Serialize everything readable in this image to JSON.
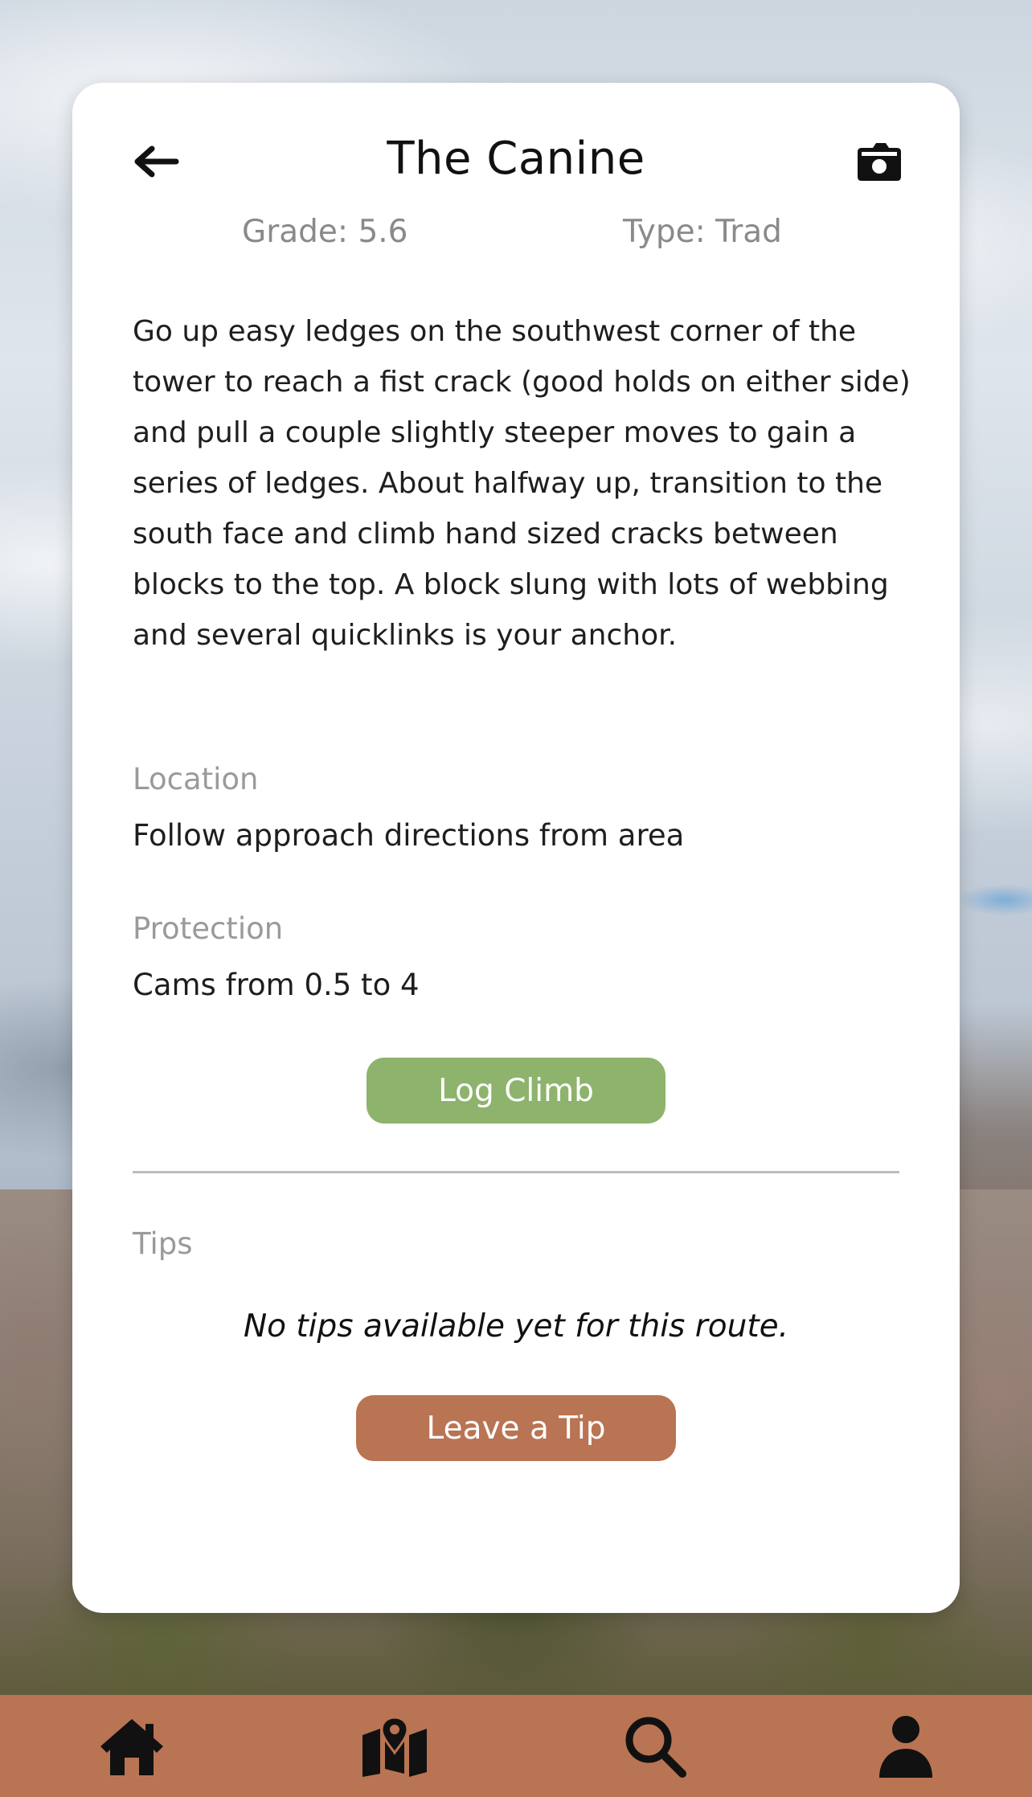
{
  "route": {
    "title": "The Canine",
    "grade": "Grade: 5.6",
    "type": "Type: Trad",
    "description": "Go up easy ledges on the southwest corner of the tower to reach a fist crack (good holds on either side) and pull a couple slightly steeper moves to gain a series of ledges. About halfway up, transition to the south face and climb hand sized cracks between blocks to the top. A block slung with lots of webbing and several quicklinks is your anchor.",
    "location_label": "Location",
    "location_value": "Follow approach directions from area",
    "protection_label": "Protection",
    "protection_value": "Cams from 0.5 to 4"
  },
  "actions": {
    "log_climb": "Log Climb",
    "leave_tip": "Leave a Tip"
  },
  "tips": {
    "label": "Tips",
    "empty_message": "No tips available yet for this route."
  },
  "header_icons": {
    "back": "back-arrow-icon",
    "camera": "camera-icon"
  },
  "nav": {
    "items": [
      {
        "name": "home",
        "icon": "home-icon"
      },
      {
        "name": "map",
        "icon": "map-icon"
      },
      {
        "name": "search",
        "icon": "search-icon"
      },
      {
        "name": "profile",
        "icon": "user-icon"
      }
    ]
  },
  "colors": {
    "log_button": "#8db36c",
    "tip_button": "#b97453",
    "nav_bar": "#b97453",
    "card": "#ffffff"
  }
}
